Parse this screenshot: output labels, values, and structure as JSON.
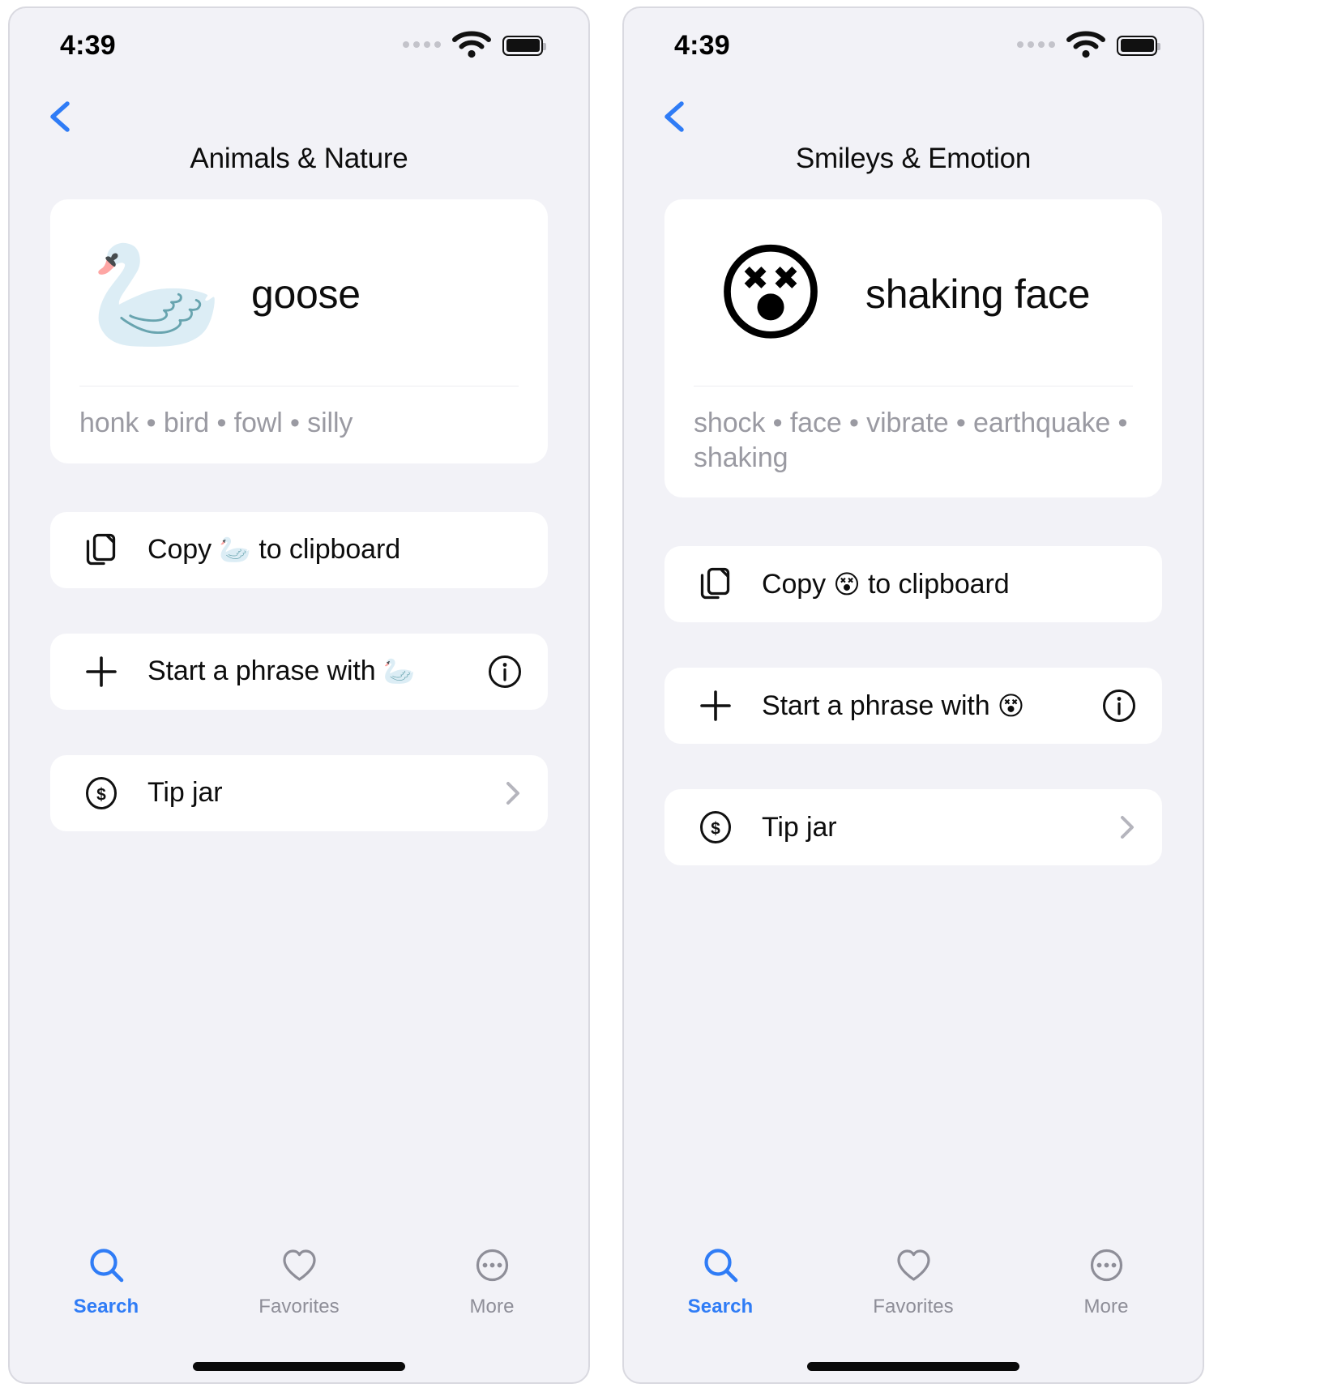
{
  "panels": [
    {
      "status": {
        "time": "4:39",
        "cellular_icon": "cellular-dots-icon",
        "wifi_icon": "wifi-icon",
        "battery_icon": "battery-icon"
      },
      "nav": {
        "back_icon": "chevron-left-icon",
        "title": "Animals & Nature"
      },
      "card": {
        "emoji": "🦢",
        "name": "goose",
        "keywords": "honk • bird • fowl • silly"
      },
      "actions": [
        {
          "lead_icon": "copy-icon",
          "label_prefix": "Copy ",
          "emoji": "🦢",
          "label_suffix": " to clipboard",
          "trail_icon": "none"
        },
        {
          "lead_icon": "plus-icon",
          "label_prefix": "Start a phrase with ",
          "emoji": "🦢",
          "label_suffix": "",
          "trail_icon": "info-circle-icon"
        },
        {
          "lead_icon": "dollar-circle-icon",
          "label_prefix": "Tip jar",
          "emoji": "",
          "label_suffix": "",
          "trail_icon": "chevron-right-icon"
        }
      ],
      "tabs": [
        {
          "icon": "search-icon",
          "label": "Search",
          "active": true
        },
        {
          "icon": "heart-icon",
          "label": "Favorites",
          "active": false
        },
        {
          "icon": "ellipsis-circle-icon",
          "label": "More",
          "active": false
        }
      ]
    },
    {
      "status": {
        "time": "4:39",
        "cellular_icon": "cellular-dots-icon",
        "wifi_icon": "wifi-icon",
        "battery_icon": "battery-icon"
      },
      "nav": {
        "back_icon": "chevron-left-icon",
        "title": "Smileys & Emotion"
      },
      "card": {
        "emoji": "😵",
        "name": "shaking face",
        "keywords": "shock • face • vibrate • earthquake • shaking"
      },
      "actions": [
        {
          "lead_icon": "copy-icon",
          "label_prefix": "Copy ",
          "emoji": "😵",
          "label_suffix": " to clipboard",
          "trail_icon": "none"
        },
        {
          "lead_icon": "plus-icon",
          "label_prefix": "Start a phrase with ",
          "emoji": "😵",
          "label_suffix": "",
          "trail_icon": "info-circle-icon"
        },
        {
          "lead_icon": "dollar-circle-icon",
          "label_prefix": "Tip jar",
          "emoji": "",
          "label_suffix": "",
          "trail_icon": "chevron-right-icon"
        }
      ],
      "tabs": [
        {
          "icon": "search-icon",
          "label": "Search",
          "active": true
        },
        {
          "icon": "heart-icon",
          "label": "Favorites",
          "active": false
        },
        {
          "icon": "ellipsis-circle-icon",
          "label": "More",
          "active": false
        }
      ]
    }
  ],
  "colors": {
    "accent": "#2f7cf6",
    "page_bg": "#f2f2f7",
    "card_bg": "#ffffff",
    "primary_text": "#0d0d0d",
    "secondary_text": "#9a9aa2",
    "tab_inactive": "#8e8e98"
  }
}
